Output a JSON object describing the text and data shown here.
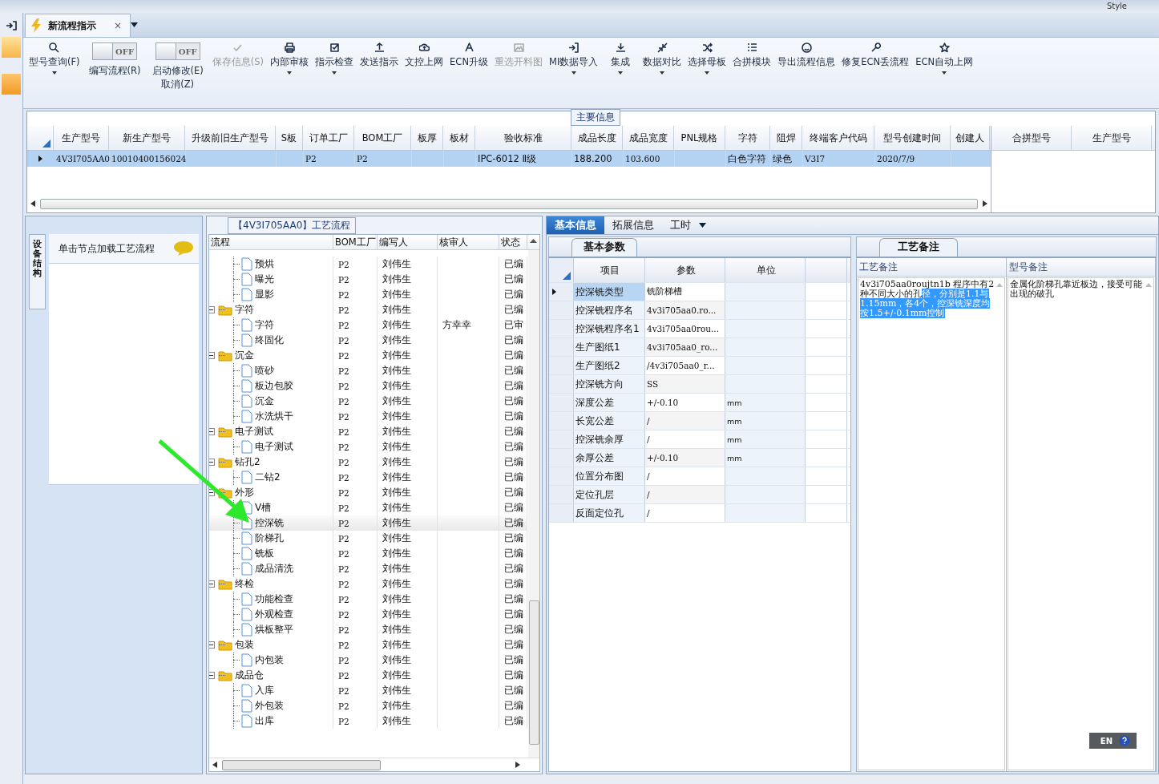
{
  "top_bar": {
    "style_label": "Style"
  },
  "document_tab": {
    "title": "新流程指示",
    "close": "×",
    "selected": true
  },
  "toolbar": [
    {
      "kind": "button",
      "label": "型号查询(F)",
      "dropdown": true,
      "disabled": false
    },
    {
      "kind": "toggle",
      "state": "OFF",
      "on": false,
      "label": "编写流程(R)"
    },
    {
      "kind": "toggle",
      "state": "OFF",
      "on": false,
      "label": "启动修改(E)",
      "label2": "取消(Z)"
    },
    {
      "kind": "button",
      "label": "保存信息(S)",
      "dropdown": false,
      "disabled": true
    },
    {
      "kind": "button",
      "label": "内部审核",
      "dropdown": true,
      "disabled": false
    },
    {
      "kind": "button",
      "label": "指示检查",
      "dropdown": true,
      "disabled": false
    },
    {
      "kind": "button",
      "label": "发送指示",
      "dropdown": false,
      "disabled": false
    },
    {
      "kind": "button",
      "label": "文控上网",
      "dropdown": false,
      "disabled": false
    },
    {
      "kind": "button",
      "label": "ECN升级",
      "dropdown": false,
      "disabled": false
    },
    {
      "kind": "button",
      "label": "重选开料图",
      "dropdown": false,
      "disabled": true
    },
    {
      "kind": "button",
      "label": "MI数据导入",
      "dropdown": true,
      "disabled": false
    },
    {
      "kind": "button",
      "label": "集成",
      "dropdown": true,
      "disabled": false
    },
    {
      "kind": "button",
      "label": "数据对比",
      "dropdown": true,
      "disabled": false
    },
    {
      "kind": "button",
      "label": "选择母板",
      "dropdown": true,
      "disabled": false
    },
    {
      "kind": "button",
      "label": "合拼模块",
      "dropdown": false,
      "disabled": false
    },
    {
      "kind": "button",
      "label": "导出流程信息",
      "dropdown": false,
      "disabled": false
    },
    {
      "kind": "button",
      "label": "修复ECN丢流程",
      "dropdown": false,
      "disabled": false
    },
    {
      "kind": "button",
      "label": "ECN自动上网",
      "dropdown": true,
      "disabled": false
    }
  ],
  "main_info": {
    "title": "主要信息",
    "columns": [
      "生产型号",
      "新生产型号",
      "升级前旧生产型号",
      "S板",
      "订单工厂",
      "BOM工厂",
      "板厚",
      "板材",
      "验收标准",
      "成品长度",
      "成品宽度",
      "PNL规格",
      "字符",
      "阻焊",
      "终端客户代码",
      "型号创建时间",
      "创建人"
    ],
    "rows": [
      {
        "selected": true,
        "cells": [
          "4V3I705AA0",
          "10010400156024",
          null,
          null,
          "P2",
          "P2",
          null,
          null,
          "IPC-6012 Ⅱ级",
          "188.200",
          "103.600",
          null,
          "白色字符",
          "绿色",
          "V3I7",
          "2020/7/9",
          null
        ]
      }
    ],
    "side_columns": [
      "合拼型号",
      "生产型号"
    ]
  },
  "left_panel": {
    "vertical_tab": "设备结构",
    "hint": "单击节点加载工艺流程"
  },
  "process_panel": {
    "title": "【4V3I705AA0】工艺流程",
    "columns": [
      "流程",
      "BOM工厂",
      "编写人",
      "核审人",
      "状态"
    ],
    "tree": [
      {
        "children": [
          {
            "label": "预烘",
            "bom": "P2",
            "author": "刘伟生",
            "status": "已编",
            "selected": false
          },
          {
            "label": "曝光",
            "bom": "P2",
            "author": "刘伟生",
            "status": "已编",
            "selected": false
          },
          {
            "label": "显影",
            "bom": "P2",
            "author": "刘伟生",
            "status": "已编",
            "selected": false
          }
        ]
      },
      {
        "label": "字符",
        "bom": "P2",
        "author": "刘伟生",
        "status": "已编",
        "selected": false,
        "expanded": true,
        "children": [
          {
            "label": "字符",
            "bom": "P2",
            "author": "刘伟生",
            "reviewer": "方幸幸",
            "status": "已审",
            "selected": false
          },
          {
            "label": "终固化",
            "bom": "P2",
            "author": "刘伟生",
            "status": "已编",
            "selected": false
          }
        ]
      },
      {
        "label": "沉金",
        "bom": "P2",
        "author": "刘伟生",
        "status": "已编",
        "selected": false,
        "expanded": true,
        "children": [
          {
            "label": "喷砂",
            "bom": "P2",
            "author": "刘伟生",
            "status": "已编",
            "selected": false
          },
          {
            "label": "板边包胶",
            "bom": "P2",
            "author": "刘伟生",
            "status": "已编",
            "selected": false
          },
          {
            "label": "沉金",
            "bom": "P2",
            "author": "刘伟生",
            "status": "已编",
            "selected": false
          },
          {
            "label": "水洗烘干",
            "bom": "P2",
            "author": "刘伟生",
            "status": "已编",
            "selected": false
          }
        ]
      },
      {
        "label": "电子测试",
        "bom": "P2",
        "author": "刘伟生",
        "status": "已编",
        "selected": false,
        "expanded": true,
        "children": [
          {
            "label": "电子测试",
            "bom": "P2",
            "author": "刘伟生",
            "status": "已编",
            "selected": false
          }
        ]
      },
      {
        "label": "钻孔2",
        "bom": "P2",
        "author": "刘伟生",
        "status": "已编",
        "selected": false,
        "expanded": true,
        "children": [
          {
            "label": "二钻2",
            "bom": "P2",
            "author": "刘伟生",
            "status": "已编",
            "selected": false
          }
        ]
      },
      {
        "label": "外形",
        "bom": "P2",
        "author": "刘伟生",
        "status": "已编",
        "selected": false,
        "expanded": true,
        "children": [
          {
            "label": "V槽",
            "bom": "P2",
            "author": "刘伟生",
            "status": "已编",
            "selected": false
          },
          {
            "label": "控深铣",
            "bom": "P2",
            "author": "刘伟生",
            "status": "已编",
            "selected": true
          },
          {
            "label": "阶梯孔",
            "bom": "P2",
            "author": "刘伟生",
            "status": "已编",
            "selected": false
          },
          {
            "label": "铣板",
            "bom": "P2",
            "author": "刘伟生",
            "status": "已编",
            "selected": false
          },
          {
            "label": "成品清洗",
            "bom": "P2",
            "author": "刘伟生",
            "status": "已编",
            "selected": false
          }
        ]
      },
      {
        "label": "终检",
        "bom": "P2",
        "author": "刘伟生",
        "status": "已编",
        "selected": false,
        "expanded": true,
        "children": [
          {
            "label": "功能检查",
            "bom": "P2",
            "author": "刘伟生",
            "status": "已编",
            "selected": false
          },
          {
            "label": "外观检查",
            "bom": "P2",
            "author": "刘伟生",
            "status": "已编",
            "selected": false
          },
          {
            "label": "烘板整平",
            "bom": "P2",
            "author": "刘伟生",
            "status": "已编",
            "selected": false
          }
        ]
      },
      {
        "label": "包装",
        "bom": "P2",
        "author": "刘伟生",
        "status": "已编",
        "selected": false,
        "expanded": true,
        "children": [
          {
            "label": "内包装",
            "bom": "P2",
            "author": "刘伟生",
            "status": "已编",
            "selected": false
          }
        ]
      },
      {
        "label": "成品仓",
        "bom": "P2",
        "author": "刘伟生",
        "status": "已编",
        "selected": false,
        "expanded": true,
        "children": [
          {
            "label": "入库",
            "bom": "P2",
            "author": "刘伟生",
            "status": "已编",
            "selected": false
          },
          {
            "label": "外包装",
            "bom": "P2",
            "author": "刘伟生",
            "status": "已编",
            "selected": false
          },
          {
            "label": "出库",
            "bom": "P2",
            "author": "刘伟生",
            "status": "已编",
            "selected": false
          }
        ]
      }
    ]
  },
  "info_tabs": [
    {
      "label": "基本信息",
      "selected": true
    },
    {
      "label": "拓展信息",
      "selected": false
    },
    {
      "label": "工时",
      "selected": false
    }
  ],
  "params": {
    "tab": "基本参数",
    "columns": [
      "项目",
      "参数",
      "单位"
    ],
    "rows": [
      {
        "item": "控深铣类型",
        "value": "铣阶梯槽",
        "selected": true
      },
      {
        "item": "控深铣程序名",
        "value": "4v3i705aa0.ro...",
        "selected": false
      },
      {
        "item": "控深铣程序名1",
        "value": "4v3i705aa0rou...",
        "selected": false
      },
      {
        "item": "生产图纸1",
        "value": "4v3i705aa0_ro...",
        "selected": false
      },
      {
        "item": "生产图纸2",
        "value": "/4v3i705aa0_r...",
        "selected": false
      },
      {
        "item": "控深铣方向",
        "value": "SS",
        "selected": false
      },
      {
        "item": "深度公差",
        "value": "+/-0.10",
        "unit": "mm",
        "selected": false
      },
      {
        "item": "长宽公差",
        "value": "/",
        "unit": "mm",
        "selected": false
      },
      {
        "item": "控深铣余厚",
        "value": "/",
        "unit": "mm",
        "selected": false
      },
      {
        "item": "余厚公差",
        "value": "+/-0.10",
        "unit": "mm",
        "selected": false
      },
      {
        "item": "位置分布图",
        "value": "/",
        "selected": false
      },
      {
        "item": "定位孔层",
        "value": "/",
        "selected": false
      },
      {
        "item": "反面定位孔",
        "value": "/",
        "selected": false
      }
    ]
  },
  "notes": {
    "tab": "工艺备注",
    "columns": [
      {
        "title": "工艺备注",
        "text": "4v3i705aa0roujtn1b 程序中有2种不同大小的孔",
        "selected_text": "径，分别是1.1与1.15mm，各4个，控深铣深度均按1.5+/-0.1mm控制"
      },
      {
        "title": "型号备注",
        "text": "金属化阶梯孔靠近板边，接受可能出现的破孔"
      }
    ]
  },
  "language_bar": {
    "language": "EN"
  }
}
